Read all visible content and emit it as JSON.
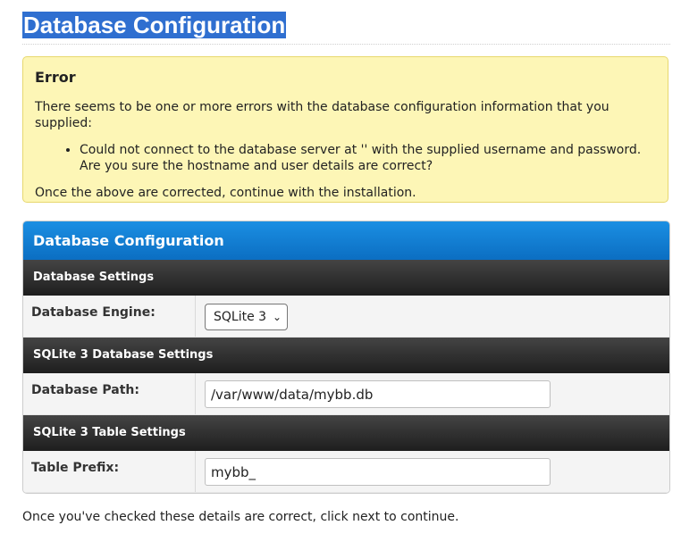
{
  "page": {
    "title": "Database Configuration"
  },
  "error": {
    "title": "Error",
    "intro": "There seems to be one or more errors with the database configuration information that you supplied:",
    "items": [
      "Could not connect to the database server at '' with the supplied username and password. Are you sure the hostname and user details are correct?"
    ],
    "outro": "Once the above are corrected, continue with the installation."
  },
  "panel": {
    "title": "Database Configuration",
    "sections": {
      "database_settings": "Database Settings",
      "sqlite_database_settings": "SQLite 3 Database Settings",
      "sqlite_table_settings": "SQLite 3 Table Settings"
    },
    "fields": {
      "engine_label": "Database Engine:",
      "engine_value": "SQLite 3",
      "path_label": "Database Path:",
      "path_value": "/var/www/data/mybb.db",
      "prefix_label": "Table Prefix:",
      "prefix_value": "mybb_"
    }
  },
  "footer": {
    "text": "Once you've checked these details are correct, click next to continue."
  },
  "colors": {
    "title_highlight": "#2f6fd0",
    "error_background": "#fdf6b6",
    "panel_header": "#0b6ec2",
    "section_row": "#1e1e1e"
  },
  "icons": {
    "select_chevron": "chevron-down-icon"
  }
}
